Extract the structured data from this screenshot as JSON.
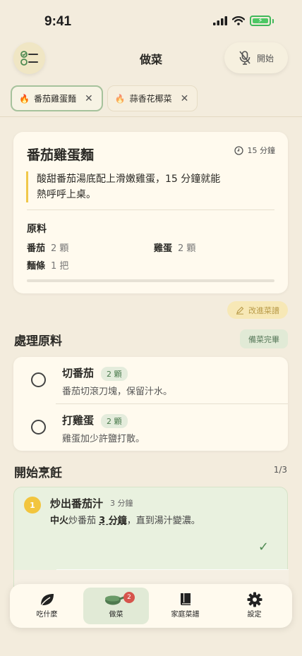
{
  "status": {
    "time": "9:41"
  },
  "header": {
    "title": "做菜",
    "start_label": "開始"
  },
  "tabs": [
    {
      "label": "番茄雞蛋麵",
      "active": true
    },
    {
      "label": "蒜香花椰菜",
      "active": false
    }
  ],
  "recipe": {
    "name": "番茄雞蛋麵",
    "time": "15 分鐘",
    "description_line1": "酸甜番茄湯底配上滑嫩雞蛋，15 分鐘就能",
    "description_line2": "熱呼呼上桌。",
    "ingredients_title": "原料",
    "ingredients": [
      {
        "name": "番茄",
        "qty": "2 顆"
      },
      {
        "name": "雞蛋",
        "qty": "2 顆"
      },
      {
        "name": "麵條",
        "qty": "1 把"
      }
    ]
  },
  "improve_label": "改進菜譜",
  "prep": {
    "title": "處理原料",
    "done_label": "備菜完畢",
    "items": [
      {
        "name": "切番茄",
        "badge": "2 顆",
        "note": "番茄切滾刀塊，保留汁水。"
      },
      {
        "name": "打雞蛋",
        "badge": "2 顆",
        "note": "雞蛋加少許鹽打散。"
      }
    ]
  },
  "cook": {
    "title": "開始烹飪",
    "counter": "1/3",
    "step": {
      "num": "1",
      "title": "炒出番茄汁",
      "duration": "3 分鐘",
      "heat": "中火",
      "verb": "炒番茄",
      "time": "3 分鐘",
      "rest": "，直到湯汁變濃。"
    }
  },
  "nav": {
    "items": [
      {
        "label": "吃什麼",
        "icon": "leaf-icon"
      },
      {
        "label": "做菜",
        "icon": "pan-icon",
        "badge": "2"
      },
      {
        "label": "家庭菜譜",
        "icon": "book-icon"
      },
      {
        "label": "設定",
        "icon": "gear-icon"
      }
    ],
    "active_index": 1
  },
  "colors": {
    "accent": "#f2c53e",
    "green": "#4f8a52",
    "background": "#f3ecdd"
  }
}
